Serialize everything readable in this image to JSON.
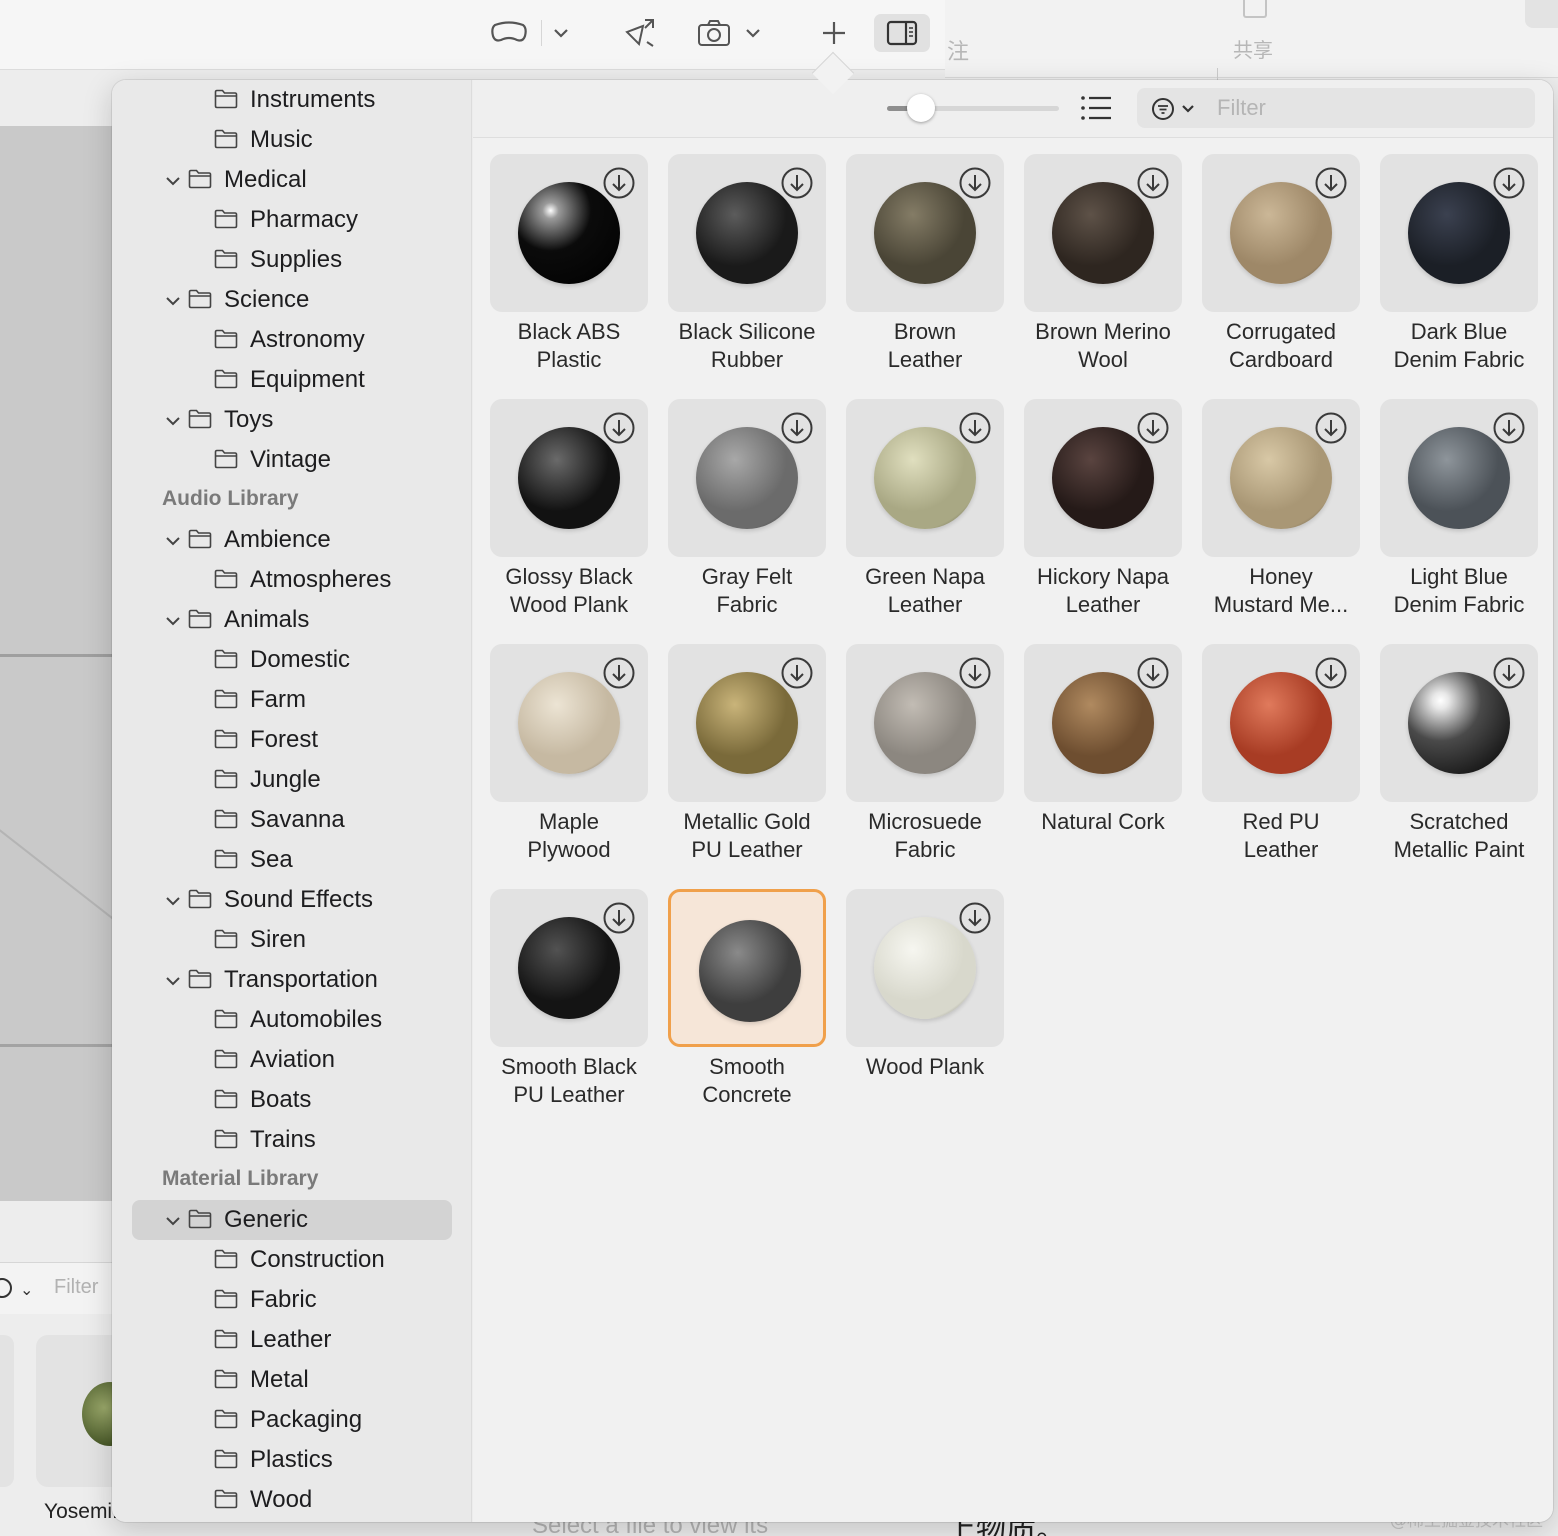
{
  "toolbar": {
    "buttons": [
      "view-mode-icon",
      "chevron-down-icon",
      "transform-icon",
      "camera-icon",
      "chevron-down-icon",
      "plus-icon",
      "sidebar-toggle-icon"
    ]
  },
  "background": {
    "right_header_col1": "注",
    "right_header_col2": "共享",
    "bottom_filter_placeholder": "Filter",
    "file_name": "Yosemi...",
    "select_hint": "Select a file to view its",
    "chinese_text": "上物质。",
    "watermark": "@稀土掘金技术社区"
  },
  "sidebar": {
    "rows": [
      {
        "label": "Instruments",
        "level": 2,
        "expanded": false
      },
      {
        "label": "Music",
        "level": 2,
        "expanded": false
      },
      {
        "label": "Medical",
        "level": 1,
        "expanded": true
      },
      {
        "label": "Pharmacy",
        "level": 2,
        "expanded": false
      },
      {
        "label": "Supplies",
        "level": 2,
        "expanded": false
      },
      {
        "label": "Science",
        "level": 1,
        "expanded": true
      },
      {
        "label": "Astronomy",
        "level": 2,
        "expanded": false
      },
      {
        "label": "Equipment",
        "level": 2,
        "expanded": false
      },
      {
        "label": "Toys",
        "level": 1,
        "expanded": true
      },
      {
        "label": "Vintage",
        "level": 2,
        "expanded": false
      },
      {
        "section": "Audio Library"
      },
      {
        "label": "Ambience",
        "level": 1,
        "expanded": true
      },
      {
        "label": "Atmospheres",
        "level": 2,
        "expanded": false
      },
      {
        "label": "Animals",
        "level": 1,
        "expanded": true
      },
      {
        "label": "Domestic",
        "level": 2,
        "expanded": false
      },
      {
        "label": "Farm",
        "level": 2,
        "expanded": false
      },
      {
        "label": "Forest",
        "level": 2,
        "expanded": false
      },
      {
        "label": "Jungle",
        "level": 2,
        "expanded": false
      },
      {
        "label": "Savanna",
        "level": 2,
        "expanded": false
      },
      {
        "label": "Sea",
        "level": 2,
        "expanded": false
      },
      {
        "label": "Sound Effects",
        "level": 1,
        "expanded": true
      },
      {
        "label": "Siren",
        "level": 2,
        "expanded": false
      },
      {
        "label": "Transportation",
        "level": 1,
        "expanded": true
      },
      {
        "label": "Automobiles",
        "level": 2,
        "expanded": false
      },
      {
        "label": "Aviation",
        "level": 2,
        "expanded": false
      },
      {
        "label": "Boats",
        "level": 2,
        "expanded": false
      },
      {
        "label": "Trains",
        "level": 2,
        "expanded": false
      },
      {
        "section": "Material Library"
      },
      {
        "label": "Generic",
        "level": 1,
        "expanded": true,
        "selected": true
      },
      {
        "label": "Construction",
        "level": 2,
        "expanded": false
      },
      {
        "label": "Fabric",
        "level": 2,
        "expanded": false
      },
      {
        "label": "Leather",
        "level": 2,
        "expanded": false
      },
      {
        "label": "Metal",
        "level": 2,
        "expanded": false
      },
      {
        "label": "Packaging",
        "level": 2,
        "expanded": false
      },
      {
        "label": "Plastics",
        "level": 2,
        "expanded": false
      },
      {
        "label": "Wood",
        "level": 2,
        "expanded": false
      }
    ]
  },
  "content": {
    "size_slider_value": 0.2,
    "filter_placeholder": "Filter",
    "filter_value": "",
    "materials": [
      {
        "line1": "Black ABS",
        "line2": "Plastic",
        "color": "#0b0b0b",
        "highlight": "#9a9a9a",
        "glossy": true
      },
      {
        "line1": "Black Silicone",
        "line2": "Rubber",
        "color": "#1a1a1a",
        "highlight": "#5c5c5c"
      },
      {
        "line1": "Brown",
        "line2": "Leather",
        "color": "#4a4536",
        "highlight": "#847c66"
      },
      {
        "line1": "Brown Merino",
        "line2": "Wool",
        "color": "#2e2620",
        "highlight": "#5e5248"
      },
      {
        "line1": "Corrugated",
        "line2": "Cardboard",
        "color": "#9e8868",
        "highlight": "#cbb797"
      },
      {
        "line1": "Dark Blue",
        "line2": "Denim Fabric",
        "color": "#1b1f26",
        "highlight": "#3b4150"
      },
      {
        "line1": "Glossy Black",
        "line2": "Wood Plank",
        "color": "#121212",
        "highlight": "#6a6a6a"
      },
      {
        "line1": "Gray Felt",
        "line2": "Fabric",
        "color": "#6b6b6b",
        "highlight": "#a8a8a8"
      },
      {
        "line1": "Green Napa",
        "line2": "Leather",
        "color": "#a9a884",
        "highlight": "#e0dfbf"
      },
      {
        "line1": "Hickory Napa",
        "line2": "Leather",
        "color": "#251a18",
        "highlight": "#5a4440"
      },
      {
        "line1": "Honey",
        "line2": "Mustard Me...",
        "color": "#a99775",
        "highlight": "#d8c8a6"
      },
      {
        "line1": "Light Blue",
        "line2": "Denim Fabric",
        "color": "#4c5258",
        "highlight": "#8e959b"
      },
      {
        "line1": "Maple",
        "line2": "Plywood",
        "color": "#c6b9a2",
        "highlight": "#ece4d4"
      },
      {
        "line1": "Metallic Gold",
        "line2": "PU Leather",
        "color": "#7a6a3a",
        "highlight": "#c9b47a"
      },
      {
        "line1": "Microsuede",
        "line2": "Fabric",
        "color": "#8c8780",
        "highlight": "#c2bcb4"
      },
      {
        "line1": "Natural Cork",
        "line2": "",
        "color": "#6e4e30",
        "highlight": "#b08a60"
      },
      {
        "line1": "Red PU",
        "line2": "Leather",
        "color": "#a83c24",
        "highlight": "#e07a5c"
      },
      {
        "line1": "Scratched",
        "line2": "Metallic Paint",
        "color": "#4a4a4a",
        "highlight": "#e8e8e8",
        "glossy": true
      },
      {
        "line1": "Smooth Black",
        "line2": "PU Leather",
        "color": "#141414",
        "highlight": "#525252"
      },
      {
        "line1": "Smooth",
        "line2": "Concrete",
        "color": "#3e3e3e",
        "highlight": "#8a8a8a",
        "selected": true
      },
      {
        "line1": "Wood Plank",
        "line2": "",
        "color": "#d8d8cc",
        "highlight": "#f6f6f0"
      }
    ]
  }
}
